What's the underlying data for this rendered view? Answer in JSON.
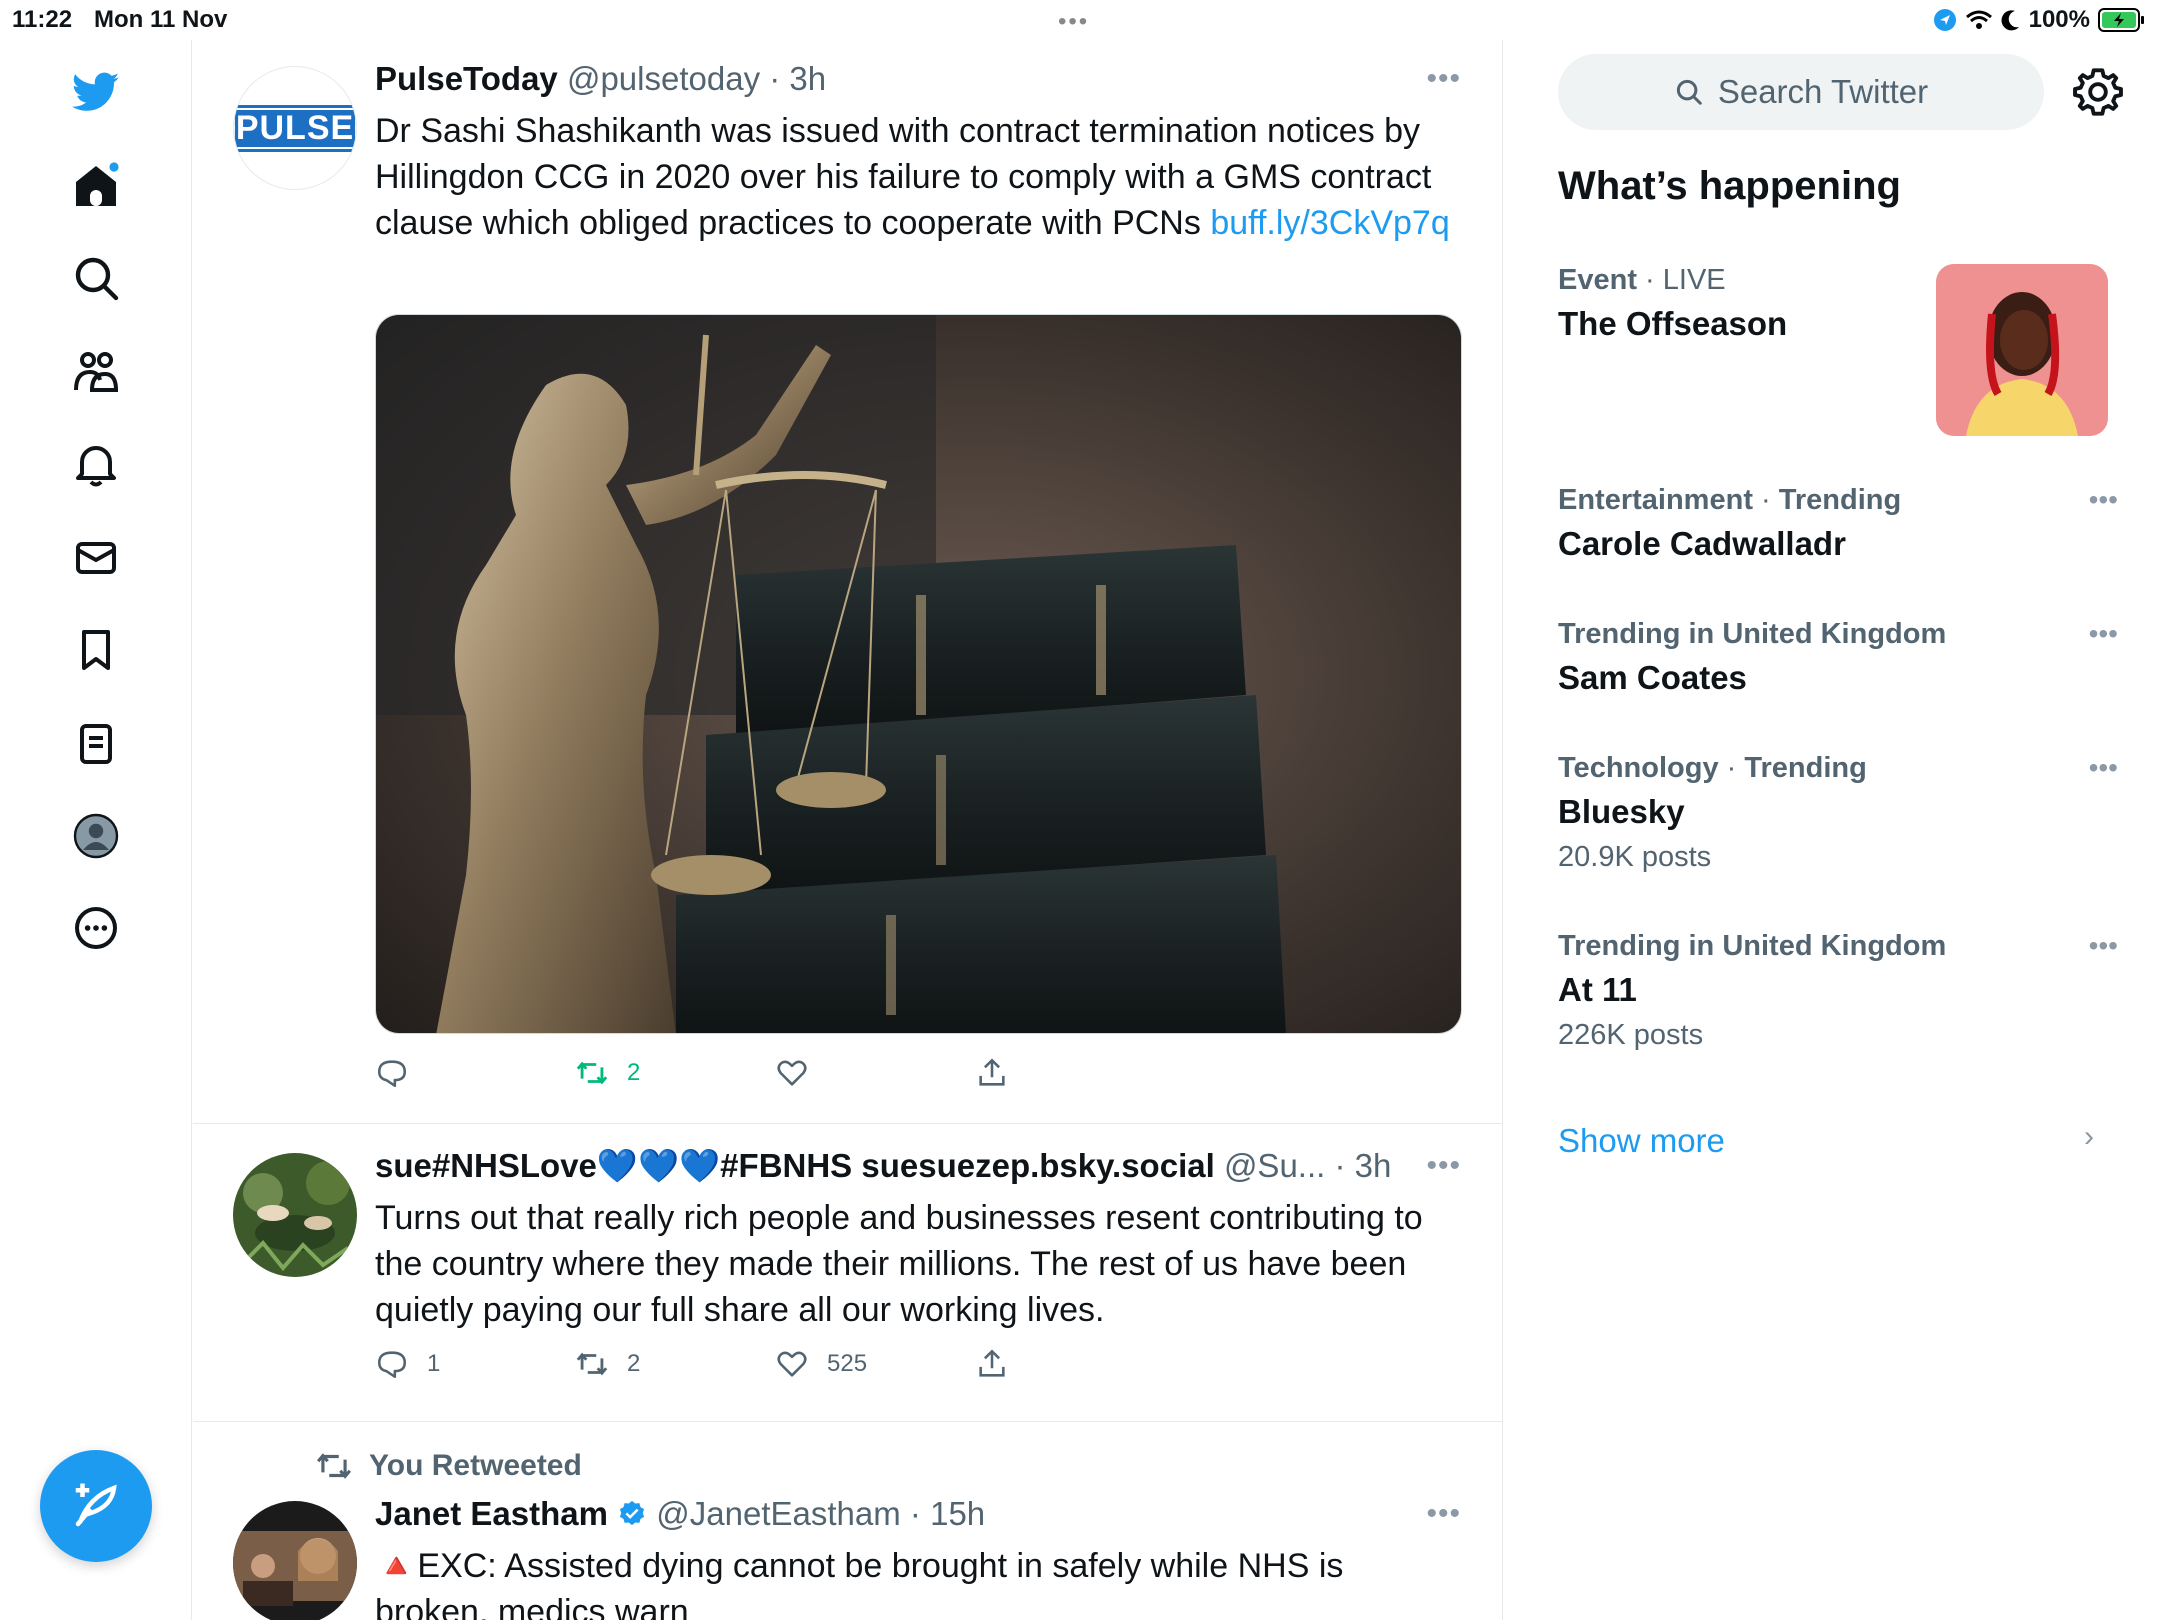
{
  "status_bar": {
    "time": "11:22",
    "date": "Mon 11 Nov",
    "battery": "100%"
  },
  "nav": {
    "items": [
      "twitter-logo",
      "home",
      "explore",
      "communities",
      "notifications",
      "messages",
      "bookmarks",
      "lists",
      "profile",
      "more"
    ]
  },
  "timeline": {
    "tweets": [
      {
        "name": "PulseToday",
        "handle": "@pulsetoday",
        "time": "3h",
        "avatar_text": "PULSE",
        "text": "Dr Sashi Shashikanth was issued with contract termination notices by Hillingdon CCG in 2020 over his failure to comply with a GMS contract clause which obliged practices to cooperate with PCNs ",
        "link": "buff.ly/3CkVp7q",
        "replies": "",
        "retweets": "2",
        "likes": ""
      },
      {
        "name": "sue#NHSLove💙💙💙#FBNHS suesuezep.bsky.social",
        "handle": "@Su...",
        "time": "3h",
        "text": "Turns out that really rich people and businesses resent contributing to the country where they made their millions.  The rest of us have been quietly paying our full share all our working lives.",
        "replies": "1",
        "retweets": "2",
        "likes": "525"
      },
      {
        "retweeted_label": "You Retweeted",
        "name": "Janet Eastham",
        "handle": "@JanetEastham",
        "time": "15h",
        "text": "🔺EXC: Assisted dying cannot be brought in safely while NHS is broken, medics warn"
      }
    ]
  },
  "right": {
    "search_placeholder": "Search Twitter",
    "section_title": "What’s happening",
    "event": {
      "category": "Event",
      "status": "LIVE",
      "title": "The Offseason"
    },
    "trends": [
      {
        "category": "Entertainment",
        "label": "Trending",
        "name": "Carole Cadwalladr",
        "count": ""
      },
      {
        "category": "Trending in United Kingdom",
        "label": "",
        "name": "Sam Coates",
        "count": ""
      },
      {
        "category": "Technology",
        "label": "Trending",
        "name": "Bluesky",
        "count": "20.9K posts"
      },
      {
        "category": "Trending in United Kingdom",
        "label": "",
        "name": "At 11",
        "count": "226K posts"
      }
    ],
    "show_more": "Show more"
  },
  "colors": {
    "accent": "#1d9bf0",
    "retweet_green": "#00ba7c",
    "muted": "#536471"
  }
}
